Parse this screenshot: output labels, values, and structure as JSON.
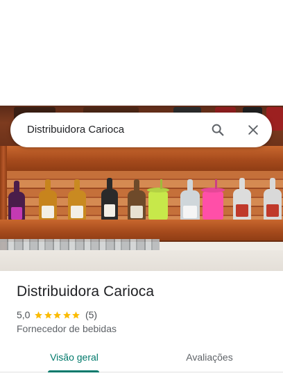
{
  "search": {
    "query": "Distribuidora Carioca",
    "icons": {
      "search": "search-icon",
      "clear": "close-icon"
    }
  },
  "hero": {
    "image": "photo of wooden pallet bar shelf with liquor bottles",
    "colors": {
      "wood": "#b2582a",
      "wall": "#ece8e2",
      "cup_green": "#c7e84a",
      "cup_pink": "#ff4fa8"
    }
  },
  "place": {
    "name": "Distribuidora Carioca",
    "rating": "5,0",
    "stars": 5,
    "review_count": "(5)",
    "category": "Fornecedor de bebidas",
    "star_color": "#fbbc04"
  },
  "tabs": [
    {
      "label": "Visão geral",
      "active": true
    },
    {
      "label": "Avaliações",
      "active": false
    }
  ],
  "theme": {
    "accent": "#00796b",
    "text_primary": "#202124",
    "text_secondary": "#5f6368"
  }
}
